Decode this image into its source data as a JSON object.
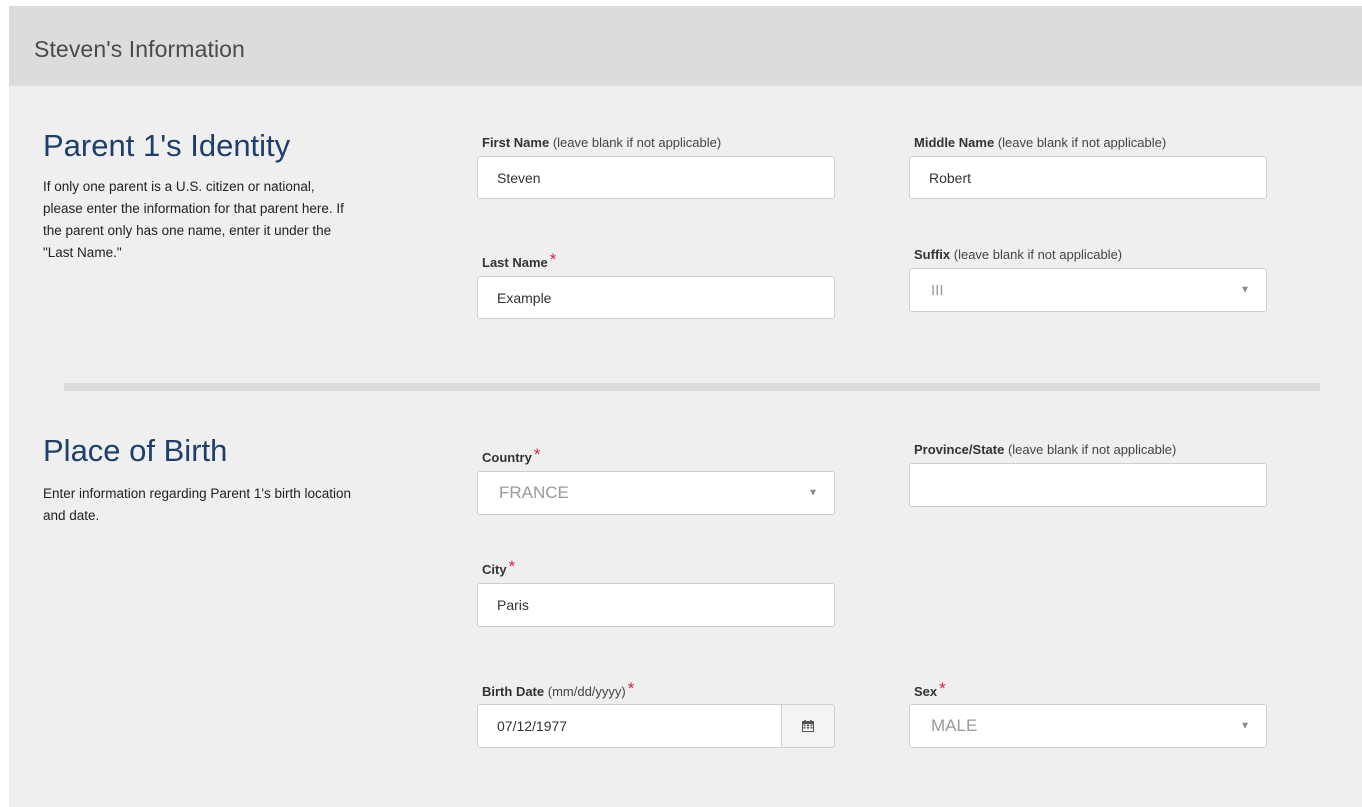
{
  "panel": {
    "title": "Steven's Information"
  },
  "identity": {
    "title": "Parent 1's Identity",
    "description_lines": [
      "If only one parent is a U.S. citizen or national,",
      "please enter the information for that parent here. If",
      "the parent only has one name, enter it under the",
      "\"Last Name.\""
    ],
    "first_name": {
      "label": "First Name",
      "hint": "(leave blank if not applicable)",
      "value": "Steven"
    },
    "middle_name": {
      "label": "Middle Name",
      "hint": "(leave blank if not applicable)",
      "value": "Robert"
    },
    "last_name": {
      "label": "Last Name",
      "required": "*",
      "value": "Example"
    },
    "suffix": {
      "label": "Suffix",
      "hint": "(leave blank if not applicable)",
      "value": "III"
    }
  },
  "birth": {
    "title": "Place of Birth",
    "description_lines": [
      "Enter information regarding Parent 1's birth location",
      "and date."
    ],
    "country": {
      "label": "Country",
      "required": "*",
      "value": "FRANCE"
    },
    "province": {
      "label": "Province/State",
      "hint": "(leave blank if not applicable)",
      "value": ""
    },
    "city": {
      "label": "City",
      "required": "*",
      "value": "Paris"
    },
    "birth_date": {
      "label": "Birth Date",
      "hint": "(mm/dd/yyyy)",
      "required": "*",
      "value": "07/12/1977"
    },
    "sex": {
      "label": "Sex",
      "required": "*",
      "value": "MALE"
    }
  },
  "icons": {
    "dropdown": "chevron-down-icon",
    "calendar": "calendar-icon"
  },
  "colors": {
    "title_blue": "#1e3f6b",
    "required_red": "#e0204a",
    "panel_bg": "#efefef",
    "header_bg": "#dcdcdc"
  }
}
